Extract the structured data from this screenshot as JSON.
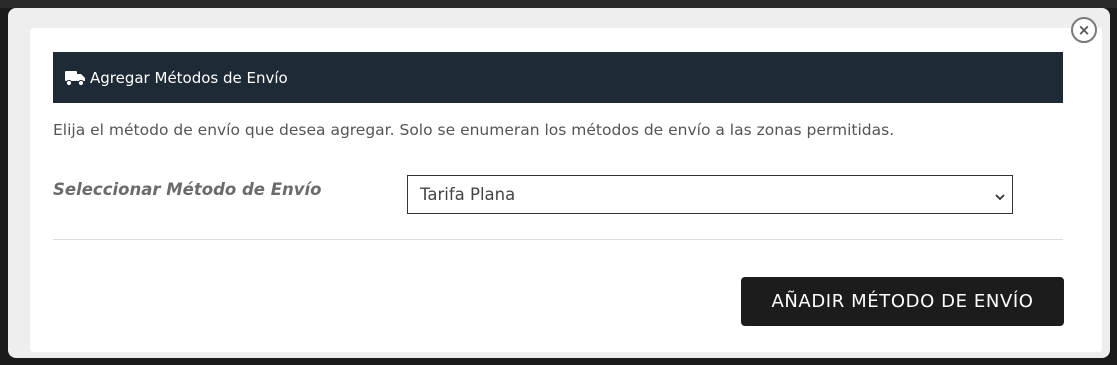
{
  "modal": {
    "close_label": "×",
    "header": {
      "icon": "truck-icon",
      "title": "Agregar Métodos de Envío"
    },
    "description": "Elija el método de envío que desea agregar. Solo se enumeran los métodos de envío a las zonas permitidas.",
    "form": {
      "label": "Seleccionar Método de Envío",
      "select_value": "Tarifa Plana"
    },
    "submit_label": "AÑADIR MÉTODO DE ENVÍO"
  },
  "colors": {
    "header_bg": "#1e2a35",
    "button_bg": "#1c1c1c"
  }
}
